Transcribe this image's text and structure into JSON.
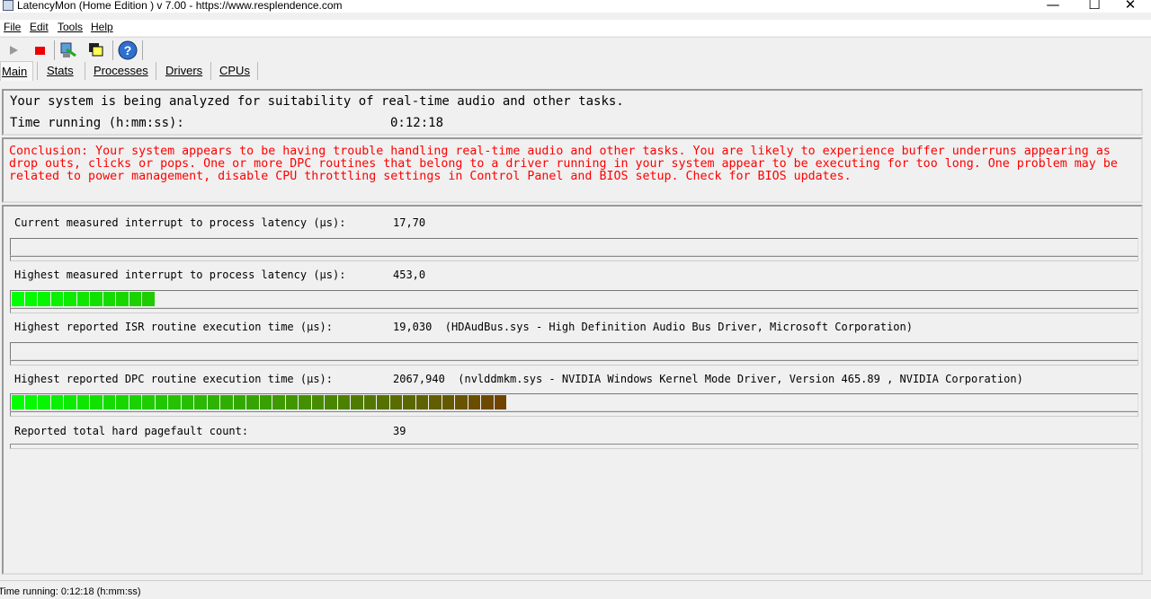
{
  "window": {
    "title": "LatencyMon  (Home Edition )  v 7.00 - https://www.resplendence.com",
    "minimize": "—",
    "maximize": "☐",
    "close": "✕"
  },
  "menu": [
    "File",
    "Edit",
    "Tools",
    "Help"
  ],
  "toolbar": {
    "icons": [
      "play-icon",
      "stop-icon",
      "monitor-icon",
      "windows-icon",
      "help-icon"
    ]
  },
  "tabs": [
    "Main",
    "Stats",
    "Processes",
    "Drivers",
    "CPUs"
  ],
  "main": {
    "analyzing": "Your system is being analyzed for suitability of real-time audio and other tasks.",
    "time_label": "Time running (h:mm:ss):",
    "time_value": "0:12:18",
    "conclusion": "Conclusion: Your system appears to be having trouble handling real-time audio and other tasks. You are likely to experience buffer underruns appearing as drop outs, clicks or pops. One or more DPC routines that belong to a driver running in your system appear to be executing for too long. One problem may be related to power management, disable CPU throttling settings in Control Panel and BIOS setup. Check for BIOS updates.",
    "conclusion_color": "#ff0000",
    "metrics": [
      {
        "label": "Current measured interrupt to process latency (µs):",
        "value": "17,70",
        "bar_fill": 0.0
      },
      {
        "label": "Highest measured interrupt to process latency (µs):",
        "value": "453,0",
        "bar_fill": 0.126
      },
      {
        "label": "Highest reported ISR routine execution time (µs):",
        "value": "19,030  (HDAudBus.sys - High Definition Audio Bus Driver, Microsoft Corporation)",
        "bar_fill": 0.0
      },
      {
        "label": "Highest reported DPC routine execution time (µs):",
        "value": "2067,940  (nvlddmkm.sys - NVIDIA Windows Kernel Mode Driver, Version 465.89 , NVIDIA Corporation)",
        "bar_fill": 0.437
      },
      {
        "label": "Reported total hard pagefault count:",
        "value": "39"
      }
    ],
    "bar_colors": {
      "start": "#00ff00",
      "end": "#704400"
    }
  },
  "status": "Time running: 0:12:18  (h:mm:ss)"
}
